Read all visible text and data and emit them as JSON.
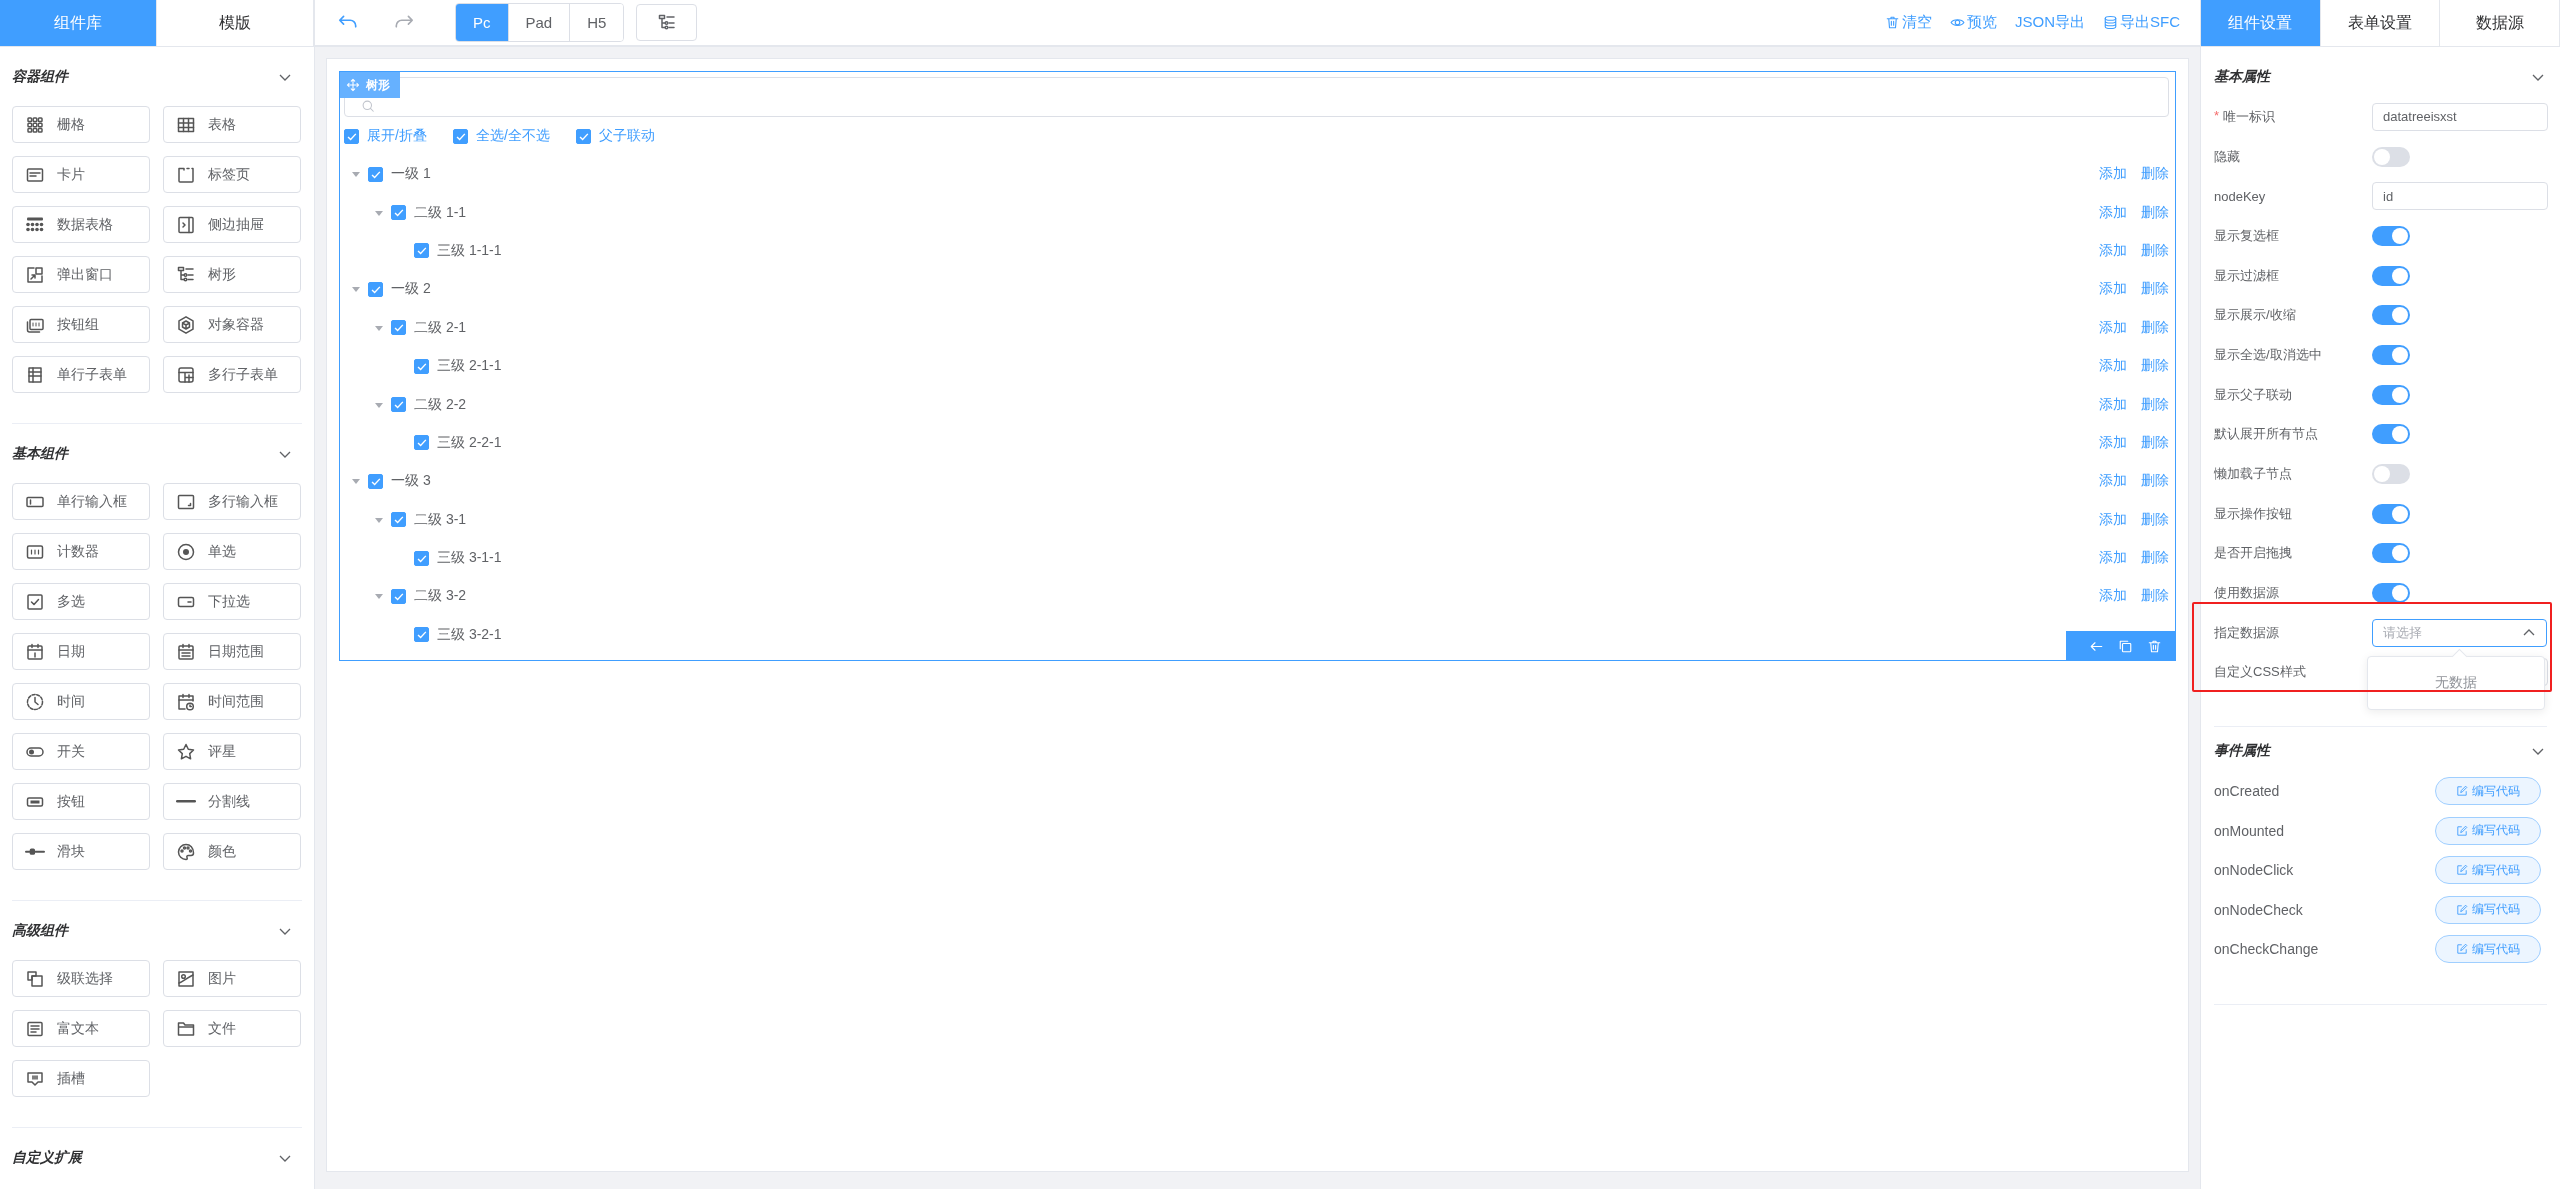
{
  "left_panel": {
    "tabs": [
      {
        "label": "组件库",
        "selected": true
      },
      {
        "label": "模版",
        "selected": false
      }
    ],
    "groups": [
      {
        "title": "容器组件",
        "expanded": true,
        "items": [
          "栅格",
          "表格",
          "卡片",
          "标签页",
          "数据表格",
          "侧边抽屉",
          "弹出窗口",
          "树形",
          "按钮组",
          "对象容器",
          "单行子表单",
          "多行子表单"
        ]
      },
      {
        "title": "基本组件",
        "expanded": true,
        "items": [
          "单行输入框",
          "多行输入框",
          "计数器",
          "单选",
          "多选",
          "下拉选",
          "日期",
          "日期范围",
          "时间",
          "时间范围",
          "开关",
          "评星",
          "按钮",
          "分割线",
          "滑块",
          "颜色"
        ]
      },
      {
        "title": "高级组件",
        "expanded": true,
        "items": [
          "级联选择",
          "图片",
          "富文本",
          "文件",
          "插槽"
        ]
      },
      {
        "title": "自定义扩展",
        "expanded": true
      }
    ]
  },
  "toolbar": {
    "undo": {
      "disabled": false
    },
    "redo": {
      "disabled": true
    },
    "devices": [
      {
        "label": "Pc",
        "selected": true
      },
      {
        "label": "Pad",
        "selected": false
      },
      {
        "label": "H5",
        "selected": false
      }
    ],
    "actions": [
      "清空",
      "预览",
      "JSON导出",
      "导出SFC"
    ]
  },
  "canvas": {
    "widget": {
      "badge": "树形",
      "options": [
        {
          "label": "展开/折叠",
          "checked": true
        },
        {
          "label": "全选/全不选",
          "checked": true
        },
        {
          "label": "父子联动",
          "checked": true
        }
      ],
      "nodes": [
        {
          "label": "一级 1",
          "checked": true,
          "expanded": true,
          "actions": [
            "添加",
            "删除"
          ],
          "children": [
            {
              "label": "二级 1-1",
              "checked": true,
              "expanded": true,
              "actions": [
                "添加",
                "删除"
              ],
              "children": [
                {
                  "label": "三级 1-1-1",
                  "checked": true,
                  "actions": [
                    "添加",
                    "删除"
                  ]
                }
              ]
            }
          ]
        },
        {
          "label": "一级 2",
          "checked": true,
          "expanded": true,
          "actions": [
            "添加",
            "删除"
          ],
          "children": [
            {
              "label": "二级 2-1",
              "checked": true,
              "expanded": true,
              "actions": [
                "添加",
                "删除"
              ],
              "children": [
                {
                  "label": "三级 2-1-1",
                  "checked": true,
                  "actions": [
                    "添加",
                    "删除"
                  ]
                }
              ]
            },
            {
              "label": "二级 2-2",
              "checked": true,
              "expanded": true,
              "actions": [
                "添加",
                "删除"
              ],
              "children": [
                {
                  "label": "三级 2-2-1",
                  "checked": true,
                  "actions": [
                    "添加",
                    "删除"
                  ]
                }
              ]
            }
          ]
        },
        {
          "label": "一级 3",
          "checked": true,
          "expanded": true,
          "actions": [
            "添加",
            "删除"
          ],
          "children": [
            {
              "label": "二级 3-1",
              "checked": true,
              "expanded": true,
              "actions": [
                "添加",
                "删除"
              ],
              "children": [
                {
                  "label": "三级 3-1-1",
                  "checked": true,
                  "actions": [
                    "添加",
                    "删除"
                  ]
                }
              ]
            },
            {
              "label": "二级 3-2",
              "checked": true,
              "expanded": true,
              "actions": [
                "添加",
                "删除"
              ],
              "children": [
                {
                  "label": "三级 3-2-1",
                  "checked": true
                }
              ]
            }
          ]
        }
      ]
    }
  },
  "right_panel": {
    "tabs": [
      {
        "label": "组件设置",
        "selected": true
      },
      {
        "label": "表单设置",
        "selected": false
      },
      {
        "label": "数据源",
        "selected": false
      }
    ],
    "basic": {
      "title": "基本属性",
      "expanded": true,
      "props": [
        {
          "kind": "input",
          "label": "唯一标识",
          "required_mark": "*",
          "value": "datatreeisxst",
          "highlighted": false
        },
        {
          "kind": "switch",
          "label": "隐藏",
          "on": false,
          "highlighted": false
        },
        {
          "kind": "input",
          "label": "nodeKey",
          "value": "id",
          "highlighted": false
        },
        {
          "kind": "switch",
          "label": "显示复选框",
          "on": true,
          "highlighted": false
        },
        {
          "kind": "switch",
          "label": "显示过滤框",
          "on": true,
          "highlighted": false
        },
        {
          "kind": "switch",
          "label": "显示展示/收缩",
          "on": true,
          "highlighted": false
        },
        {
          "kind": "switch",
          "label": "显示全选/取消选中",
          "on": true,
          "highlighted": false
        },
        {
          "kind": "switch",
          "label": "显示父子联动",
          "on": true,
          "highlighted": false
        },
        {
          "kind": "switch",
          "label": "默认展开所有节点",
          "on": true,
          "highlighted": false
        },
        {
          "kind": "switch",
          "label": "懒加载子节点",
          "on": false,
          "highlighted": false
        },
        {
          "kind": "switch",
          "label": "显示操作按钮",
          "on": true,
          "highlighted": false
        },
        {
          "kind": "switch",
          "label": "是否开启拖拽",
          "on": true,
          "highlighted": false
        },
        {
          "kind": "switch",
          "label": "使用数据源",
          "on": true,
          "highlighted": false
        },
        {
          "kind": "select",
          "label": "指定数据源",
          "placeholder": "请选择",
          "open": true,
          "empty_text": "无数据",
          "highlighted": true
        },
        {
          "kind": "input",
          "label": "自定义CSS样式",
          "highlighted": true
        }
      ]
    },
    "events": {
      "title": "事件属性",
      "expanded": true,
      "items": [
        {
          "name": "onCreated",
          "button": "编写代码"
        },
        {
          "name": "onMounted",
          "button": "编写代码"
        },
        {
          "name": "onNodeClick",
          "button": "编写代码"
        },
        {
          "name": "onNodeCheck",
          "button": "编写代码"
        },
        {
          "name": "onCheckChange",
          "button": "编写代码"
        }
      ]
    }
  }
}
